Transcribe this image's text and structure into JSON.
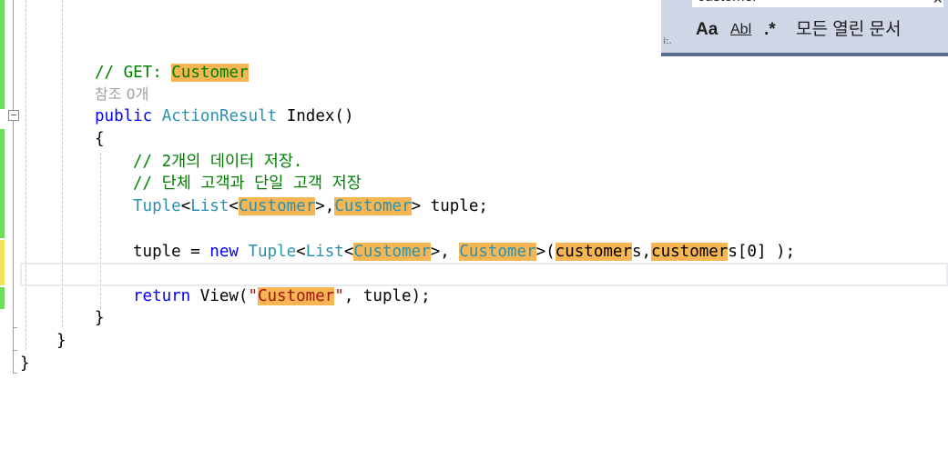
{
  "find_panel": {
    "search_value": "customer",
    "match_case_label": "Aa",
    "whole_word_label": "Abl",
    "regex_label": ".*",
    "scope_label": "모든 열린 문서"
  },
  "code": {
    "line1_comment": "// GET: ",
    "line1_hl": "Customer",
    "codelens": "참조 0개",
    "line3_kw": "public",
    "line3_type": "ActionResult",
    "line3_rest": " Index()",
    "open_brace": "{",
    "c1": "// 2개의 데이터 저장.",
    "c2": "// 단체 고객과 단일 고객 저장",
    "decl": {
      "tuple": "Tuple",
      "lt1": "<",
      "list": "List",
      "lt2": "<",
      "cust1": "Customer",
      "gt1": ">,",
      "cust2": "Customer",
      "gt2": ">",
      "var": " tuple;"
    },
    "assign": {
      "lhs": "tuple = ",
      "new": "new",
      "sp": " ",
      "tuple": "Tuple",
      "lt1": "<",
      "list": "List",
      "lt2": "<",
      "cust1": "Customer",
      "gt1": ">, ",
      "cust2": "Customer",
      "gt2": ">(",
      "arg1": "customer",
      "s1": "s,",
      "arg2": "customer",
      "s2": "s[0] );"
    },
    "ret": {
      "kw": "return",
      "view": " View(",
      "q1": "\"",
      "str": "Customer",
      "q2": "\"",
      "rest": ", tuple);"
    },
    "close_inner": "}",
    "close_class": "}",
    "close_ns": "}"
  }
}
